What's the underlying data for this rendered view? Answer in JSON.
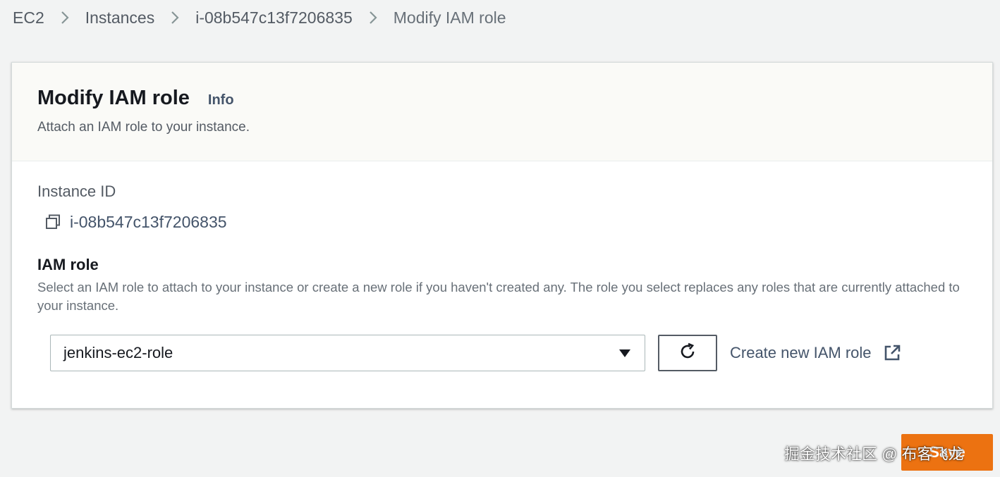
{
  "breadcrumb": {
    "items": [
      "EC2",
      "Instances",
      "i-08b547c13f7206835"
    ],
    "current": "Modify IAM role"
  },
  "header": {
    "title": "Modify IAM role",
    "info_label": "Info",
    "description": "Attach an IAM role to your instance."
  },
  "instance": {
    "label": "Instance ID",
    "value": "i-08b547c13f7206835",
    "copy_icon": "copy-icon"
  },
  "iam_role": {
    "label": "IAM role",
    "description": "Select an IAM role to attach to your instance or create a new role if you haven't created any. The role you select replaces any roles that are currently attached to your instance.",
    "selected": "jenkins-ec2-role",
    "refresh_icon": "refresh-icon",
    "create_link": "Create new IAM role",
    "external_icon": "external-link-icon"
  },
  "actions": {
    "primary_color": "#ec7211",
    "primary_label": "Save"
  },
  "watermark": "掘金技术社区 @ 布客飞龙"
}
